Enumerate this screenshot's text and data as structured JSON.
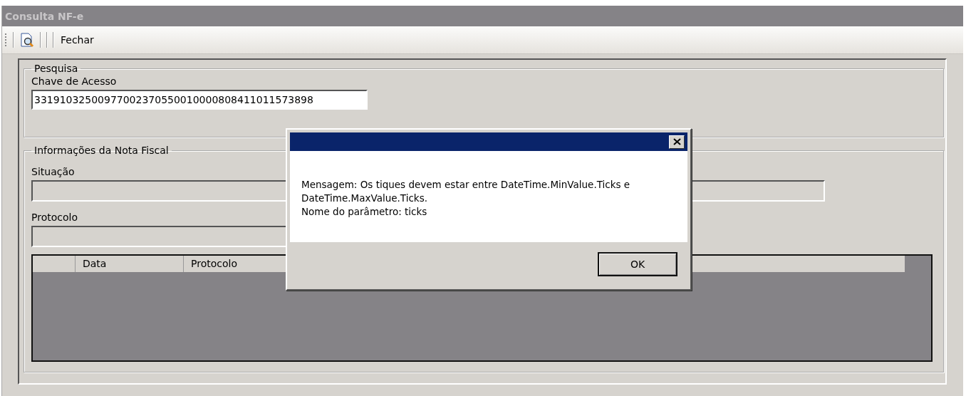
{
  "window": {
    "title": "Consulta NF-e"
  },
  "toolbar": {
    "buttons": [
      {
        "kind": "icon"
      },
      {
        "kind": "text",
        "label": "Fechar"
      }
    ]
  },
  "search_group": {
    "title": "Pesquisa",
    "field_label": "Chave de Acesso",
    "field_value": "33191032500977002370550010000808411011573898"
  },
  "info_group": {
    "title": "Informações da Nota Fiscal",
    "fields": [
      {
        "label": "Situação",
        "disabled": true
      },
      {
        "label": "Protocolo",
        "disabled": true
      }
    ],
    "table": {
      "columns": [
        "Data",
        "Protocolo"
      ]
    }
  },
  "dialog": {
    "message": "Mensagem: Os tiques devem estar entre DateTime.MinValue.Ticks e DateTime.MaxValue.Ticks.",
    "param": "Nome do parâmetro: ticks",
    "buttons": [
      "OK"
    ]
  }
}
